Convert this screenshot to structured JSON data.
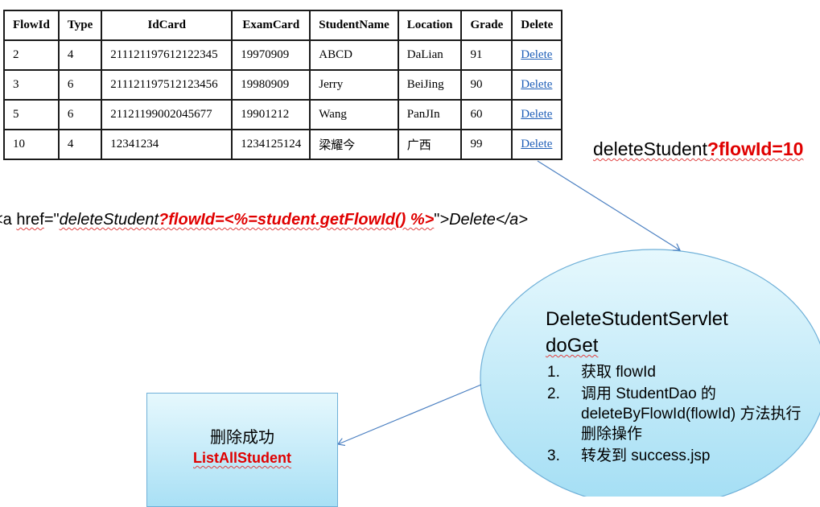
{
  "table": {
    "headers": [
      "FlowId",
      "Type",
      "IdCard",
      "ExamCard",
      "StudentName",
      "Location",
      "Grade",
      "Delete"
    ],
    "rows": [
      [
        "2",
        "4",
        "211121197612122345",
        "19970909",
        "ABCD",
        "DaLian",
        "91",
        "Delete"
      ],
      [
        "3",
        "6",
        "211121197512123456",
        "19980909",
        "Jerry",
        "BeiJing",
        "90",
        "Delete"
      ],
      [
        "5",
        "6",
        "21121199002045677",
        "19901212",
        "Wang",
        "PanJIn",
        "60",
        "Delete"
      ],
      [
        "10",
        "4",
        "12341234",
        "1234125124",
        "梁耀今",
        "广西",
        "99",
        "Delete"
      ]
    ]
  },
  "url_label": {
    "path": "deleteStudent",
    "query": "?flowId=10"
  },
  "code_snippet": {
    "prefix": "<a ",
    "href_attr": "href",
    "eq_quote": "=\"",
    "url_path": "deleteStudent",
    "url_query": "?flowId=<%=student.getFlowId() %>",
    "close_quote": "\"",
    "suffix": ">Delete</a>"
  },
  "servlet": {
    "title": "DeleteStudentServlet",
    "method": "doGet",
    "steps": [
      {
        "num": "1.",
        "text": "获取 flowId"
      },
      {
        "num": "2.",
        "text": "调用 StudentDao 的 deleteByFlowId(flowId) 方法执行删除操作"
      },
      {
        "num": "3.",
        "text": "转发到 success.jsp"
      }
    ]
  },
  "success_box": {
    "text": "删除成功",
    "link": "ListAllStudent"
  },
  "colors": {
    "accent_red": "#e00000",
    "link_blue": "#1f5fb8",
    "connector": "#4a7fc1",
    "ellipse_fill_top": "#e6f8fd",
    "ellipse_fill_bottom": "#a3def4",
    "ellipse_stroke": "#6fb0d8"
  }
}
